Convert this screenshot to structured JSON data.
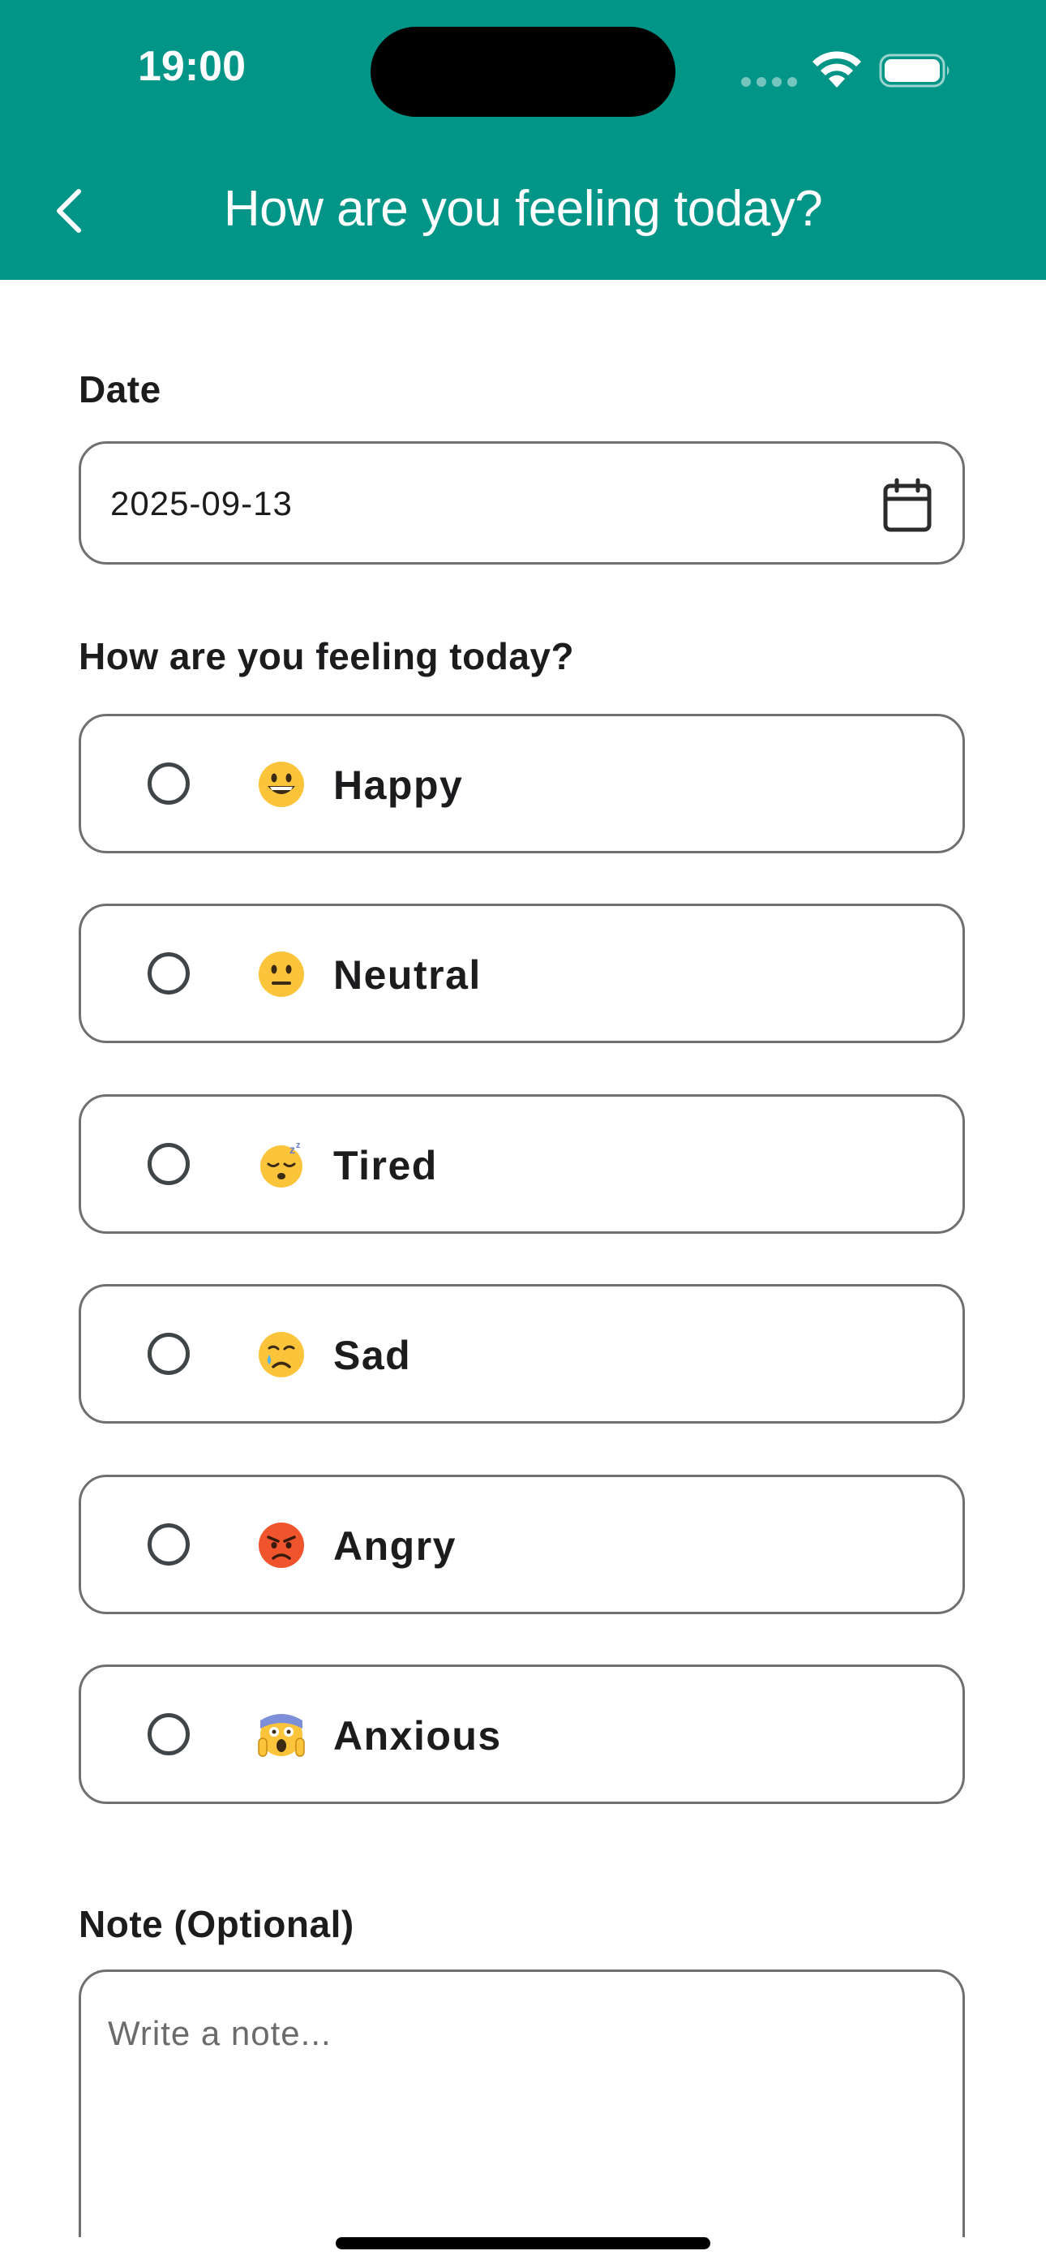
{
  "status_bar": {
    "time": "19:00"
  },
  "nav": {
    "title": "How are you feeling today?",
    "back_icon": "chevron-left-icon"
  },
  "colors": {
    "header": "#019587",
    "border": "#6f6f6f",
    "text": "#1c1c1e"
  },
  "date_section": {
    "label": "Date",
    "value": "2025-09-13",
    "icon": "calendar-icon"
  },
  "mood_section": {
    "label": "How are you feeling today?",
    "options": [
      {
        "emoji": "😀",
        "label": "Happy",
        "selected": false
      },
      {
        "emoji": "😐",
        "label": "Neutral",
        "selected": false
      },
      {
        "emoji": "😴",
        "label": "Tired",
        "selected": false
      },
      {
        "emoji": "😢",
        "label": "Sad",
        "selected": false
      },
      {
        "emoji": "😡",
        "label": "Angry",
        "selected": false
      },
      {
        "emoji": "😱",
        "label": "Anxious",
        "selected": false
      }
    ]
  },
  "note_section": {
    "label": "Note (Optional)",
    "placeholder": "Write a note...",
    "value": ""
  }
}
